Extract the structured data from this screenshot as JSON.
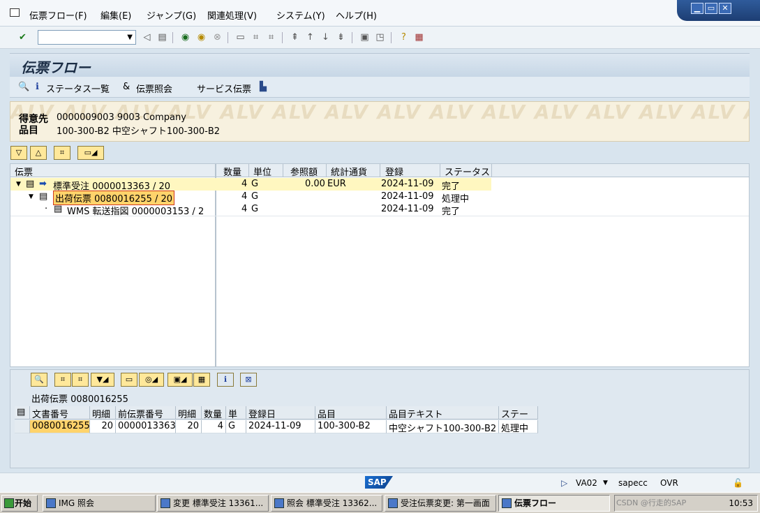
{
  "menubar": {
    "items": [
      "伝票フロー(F)",
      "編集(E)",
      "ジャンプ(G)",
      "関連処理(V)",
      "システム(Y)",
      "ヘルプ(H)"
    ]
  },
  "window_controls": {
    "minimize": "▁",
    "restore": "▭",
    "close": "✕"
  },
  "toolbar": {
    "command_field_value": "",
    "icons": [
      "enter-icon",
      "back-icon",
      "save-icon",
      "back-navigate-icon",
      "exit-icon",
      "cancel-icon",
      "print-icon",
      "find-icon",
      "find-next-icon",
      "first-page-icon",
      "previous-page-icon",
      "next-page-icon",
      "last-page-icon",
      "create-session-icon",
      "shortcut-icon",
      "help-icon",
      "layout-icon"
    ]
  },
  "title": "伝票フロー",
  "app_toolbar": {
    "status_overview": "ステータス一覧",
    "display_document": "伝票照会",
    "service_document": "サービス伝票"
  },
  "header": {
    "watermark": "ALV",
    "customer_label": "得意先",
    "customer_value": "0000009003 9003 Company",
    "material_label": "品目",
    "material_value": "100-300-B2 中空シャフト100-300-B2"
  },
  "tree": {
    "columns": [
      "伝票",
      "数量",
      "単位",
      "参照額",
      "統計通貨",
      "登録",
      "ステータス"
    ],
    "rows": [
      {
        "doc": "標準受注 0000013363 / 20",
        "qty": "4",
        "unit": "G",
        "ref_amount": "0.00",
        "currency": "EUR",
        "date": "2024-11-09",
        "status": "完了"
      },
      {
        "doc": "出荷伝票 0080016255 / 20",
        "qty": "4",
        "unit": "G",
        "ref_amount": "",
        "currency": "",
        "date": "2024-11-09",
        "status": "処理中"
      },
      {
        "doc": "WMS 転送指図 0000003153 / 2",
        "qty": "4",
        "unit": "G",
        "ref_amount": "",
        "currency": "",
        "date": "2024-11-09",
        "status": "完了"
      }
    ]
  },
  "alv": {
    "title": "出荷伝票 0080016255",
    "columns": [
      "文書番号",
      "明細",
      "前伝票番号",
      "明細",
      "数量",
      "単",
      "登録日",
      "品目",
      "品目テキスト",
      "ステー"
    ],
    "rows": [
      [
        "0080016255",
        "20",
        "0000013363",
        "20",
        "4",
        "G",
        "2024-11-09",
        "100-300-B2",
        "中空シャフト100-300-B2",
        "処理中"
      ]
    ]
  },
  "statusbar": {
    "logo": "SAP",
    "transaction": "VA02",
    "server": "sapecc",
    "mode": "OVR"
  },
  "taskbar": {
    "start": "开始",
    "tasks": [
      "IMG 照会",
      "変更 標準受注 13361...",
      "照会 標準受注 13362...",
      "受注伝票変更: 第一画面",
      "伝票フロー"
    ],
    "clock": "10:53",
    "watermark": "CSDN @行走的SAP"
  },
  "colors": {
    "highlight_row": "#fff7c0",
    "selected_cell": "#ffd36b",
    "header_bg": "#f7f1df",
    "accent": "#1d3e73"
  }
}
